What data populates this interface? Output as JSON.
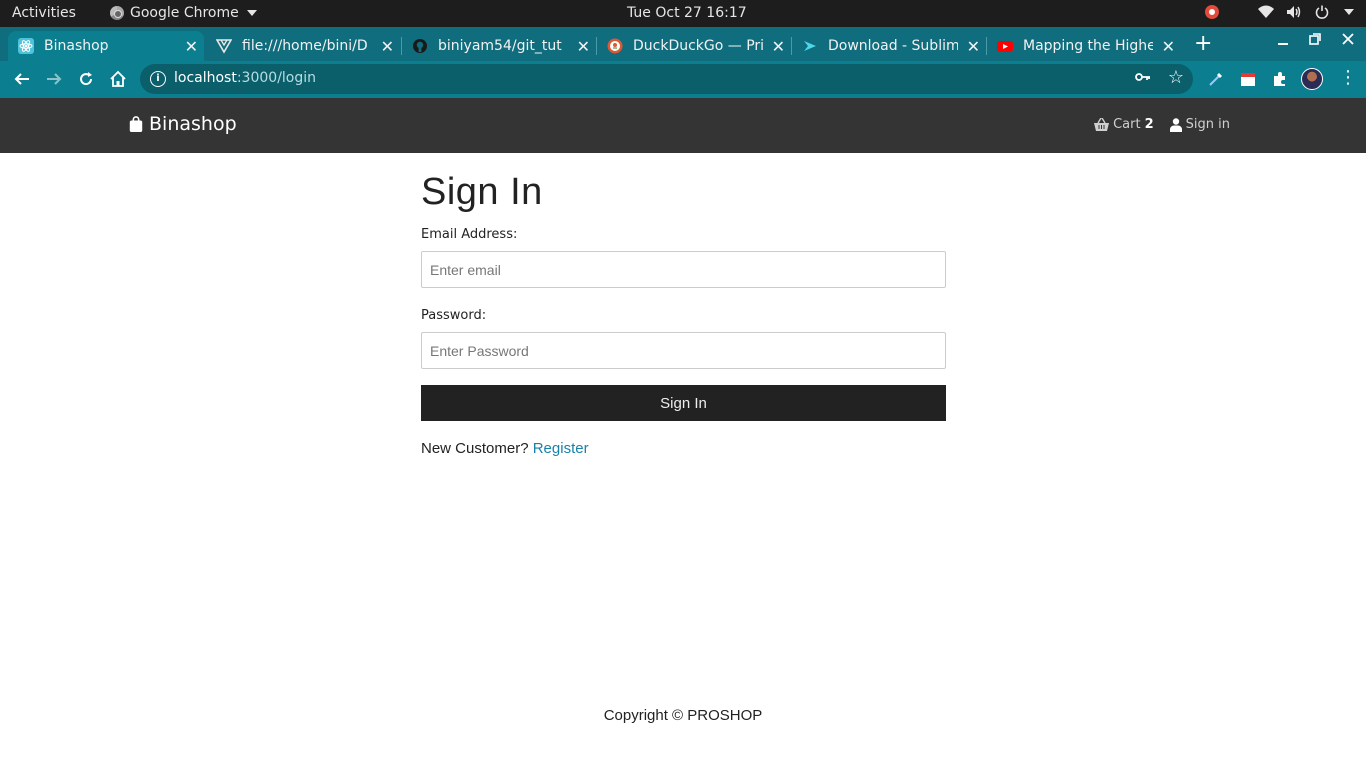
{
  "system": {
    "activities": "Activities",
    "app_name": "Google Chrome",
    "clock": "Tue Oct 27  16:17"
  },
  "tabs": [
    {
      "title": "Binashop",
      "icon": "react-icon",
      "active": true
    },
    {
      "title": "file:///home/bini/D",
      "icon": "vue-icon",
      "active": false
    },
    {
      "title": "biniyam54/git_tut",
      "icon": "github-icon",
      "active": false
    },
    {
      "title": "DuckDuckGo — Pri",
      "icon": "duckduckgo-icon",
      "active": false
    },
    {
      "title": "Download - Sublim",
      "icon": "sublime-icon",
      "active": false
    },
    {
      "title": "Mapping the Highe",
      "icon": "youtube-icon",
      "active": false
    }
  ],
  "address_bar": {
    "host": "localhost",
    "path": ":3000/login"
  },
  "navbar": {
    "brand": "Binashop",
    "cart_label": "Cart",
    "cart_count": "2",
    "signin_label": "Sign in"
  },
  "form": {
    "title": "Sign In",
    "email_label": "Email Address:",
    "email_placeholder": "Enter email",
    "password_label": "Password:",
    "password_placeholder": "Enter Password",
    "submit_label": "Sign In",
    "new_customer_text": "New Customer?",
    "register_link": "Register"
  },
  "footer": {
    "copyright": "Copyright © PROSHOP"
  },
  "colors": {
    "chrome_tabstrip": "#0f6d7e",
    "chrome_toolbar": "#0b7f8f",
    "navbar_bg": "#343434",
    "button_bg": "#222222",
    "link": "#1a82a8"
  }
}
